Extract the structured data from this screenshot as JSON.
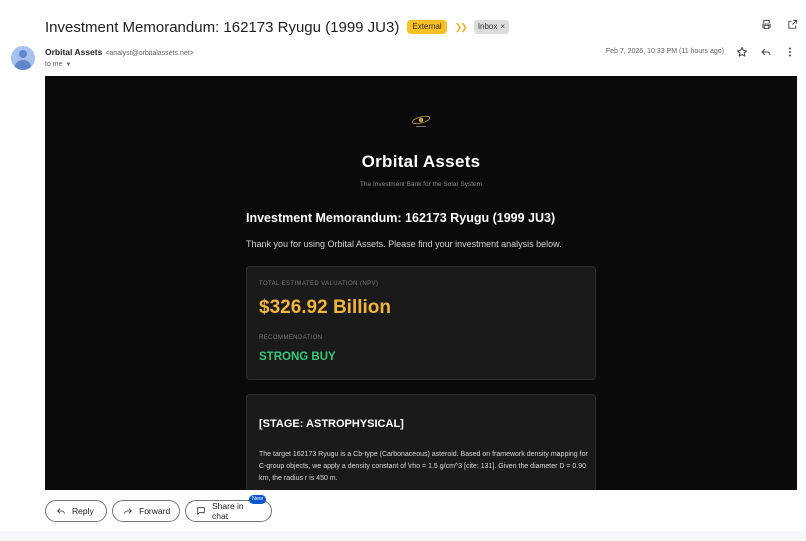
{
  "email": {
    "subject": "Investment Memorandum: 162173 Ryugu (1999 JU3)",
    "labels": {
      "external": "External",
      "inbox": "Inbox",
      "inbox_remove": "×"
    },
    "sender": {
      "name": "Orbital Assets",
      "email": "<analyst@orbitalassets.net>",
      "to": "to me"
    },
    "date": "Feb 7, 2026, 10:33 PM (11 hours ago)"
  },
  "body": {
    "brand_title": "Orbital Assets",
    "brand_tagline": "The Investment Bank for the Solar System",
    "memo_heading": "Investment Memorandum: 162173 Ryugu (1999 JU3)",
    "memo_intro": "Thank you for using Orbital Assets. Please find your investment analysis below.",
    "valuation": {
      "label": "TOTAL ESTIMATED VALUATION (NPV)",
      "value": "$326.92 Billion",
      "recommendation_label": "RECOMMENDATION",
      "recommendation_value": "STRONG BUY"
    },
    "stage": {
      "title": "[STAGE: ASTROPHYSICAL]",
      "text": "The target 162173 Ryugu is a Cb-type (Carbonaceous) asteroid. Based on framework density mapping for C-group objects, we apply a density constant of \\rho = 1.5 g/cm^3 [cite: 131]. Given the diameter D = 0.90 km, the radius r is 450 m."
    }
  },
  "actions": {
    "reply": "Reply",
    "forward": "Forward",
    "share": "Share in chat",
    "share_badge": "New"
  },
  "colors": {
    "valuation": "#f2b53a",
    "recommendation": "#35c97a",
    "external_badge": "#f6c026",
    "new_badge": "#0b57d0"
  }
}
